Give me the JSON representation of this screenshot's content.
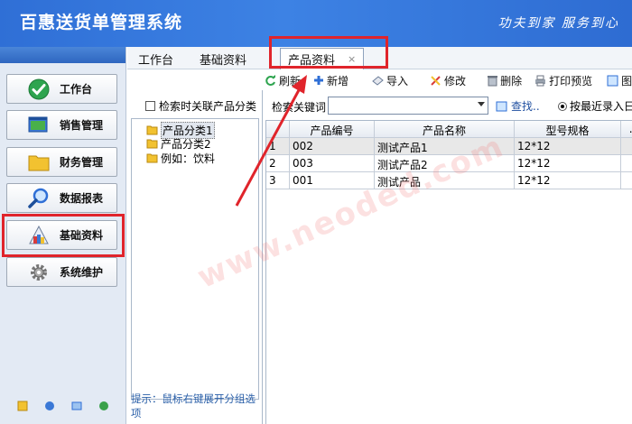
{
  "app": {
    "title": "百惠送货单管理系统",
    "slogan": "功夫到家 服务到心"
  },
  "sidebar": {
    "items": [
      {
        "label": "工作台",
        "icon": "check-circle-icon"
      },
      {
        "label": "销售管理",
        "icon": "window-icon"
      },
      {
        "label": "财务管理",
        "icon": "folder-icon"
      },
      {
        "label": "数据报表",
        "icon": "magnifier-icon"
      },
      {
        "label": "基础资料",
        "icon": "blocks-icon"
      },
      {
        "label": "系统维护",
        "icon": "gear-icon"
      }
    ]
  },
  "tabs": {
    "t1": "工作台",
    "t2": "基础资料",
    "t3": "产品资料",
    "close": "×"
  },
  "toolbar": {
    "refresh": "刷新",
    "add": "新增",
    "import": "导入",
    "edit": "修改",
    "delete": "删除",
    "print": "打印预览",
    "more": "图"
  },
  "left_panel": {
    "checkbox_label": "检索时关联产品分类",
    "tree": [
      "产品分类1",
      "产品分类2",
      "例如：饮料"
    ],
    "hint": "提示：鼠标右键展开分组选项"
  },
  "search": {
    "label": "检索关键词",
    "value": "",
    "find": "查找..",
    "radio_label": "按最近录入日期"
  },
  "table": {
    "headers": [
      "",
      "产品编号",
      "产品名称",
      "型号规格",
      "..."
    ],
    "rows": [
      [
        "1",
        "002",
        "测试产品1",
        "12*12",
        ""
      ],
      [
        "2",
        "003",
        "测试产品2",
        "12*12",
        ""
      ],
      [
        "3",
        "001",
        "测试产品",
        "12*12",
        ""
      ]
    ]
  },
  "watermark": "www.neoded.com",
  "colors": {
    "accent": "#2f6fd6",
    "highlight": "#e0242b"
  }
}
